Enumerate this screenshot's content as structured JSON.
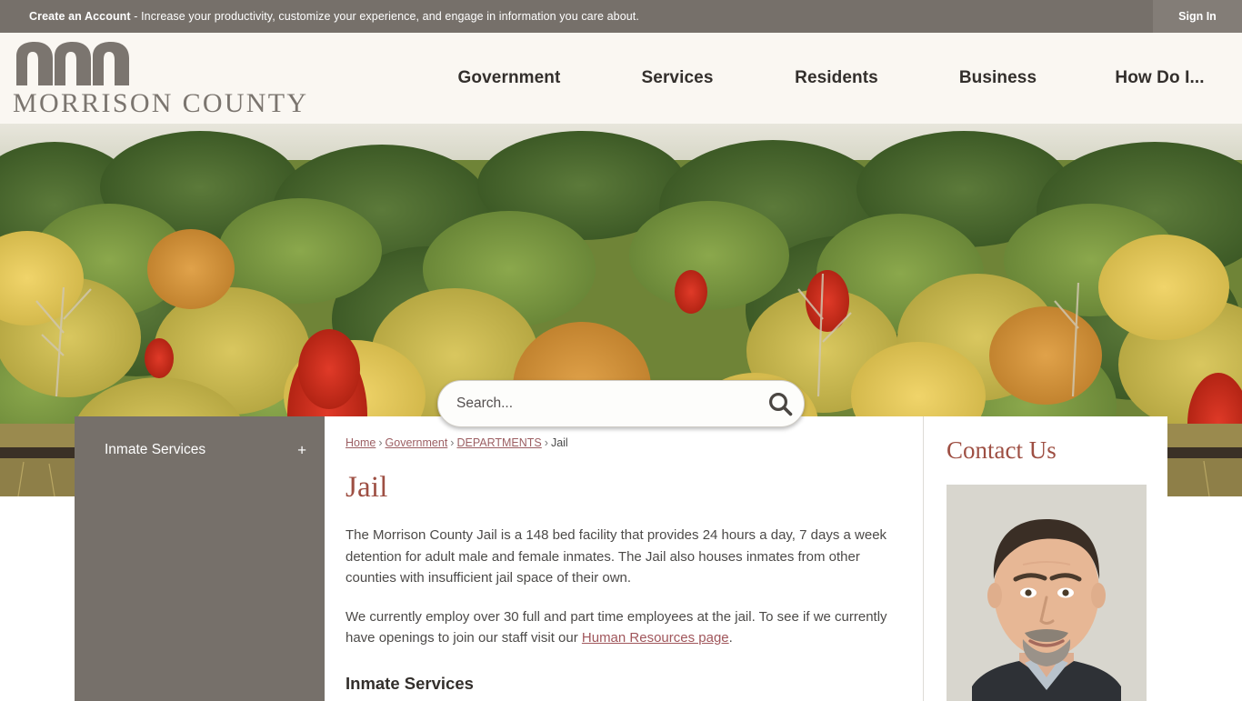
{
  "topbar": {
    "message_bold": "Create an Account",
    "message_rest": " - Increase your productivity, customize your experience, and engage in information you care about.",
    "sign_in_label": "Sign In"
  },
  "header": {
    "logo_text": "MORRISON COUNTY",
    "nav": [
      {
        "label": "Government"
      },
      {
        "label": "Services"
      },
      {
        "label": "Residents"
      },
      {
        "label": "Business"
      },
      {
        "label": "How Do I..."
      }
    ]
  },
  "hero": {
    "search": {
      "placeholder": "Search...",
      "value": "",
      "icon": "search-icon"
    }
  },
  "sidebar": {
    "items": [
      {
        "label": "Inmate Services",
        "expander": "+"
      }
    ]
  },
  "main": {
    "breadcrumb": [
      {
        "label": "Home",
        "link": true
      },
      {
        "label": "Government",
        "link": true
      },
      {
        "label": "DEPARTMENTS",
        "link": true
      },
      {
        "label": "Jail",
        "link": false
      }
    ],
    "breadcrumb_separator": "›",
    "title": "Jail",
    "paragraph_1": "The Morrison County Jail is a 148 bed facility that provides 24 hours a day, 7 days a week detention for adult male and female inmates. The Jail also houses inmates from other counties with insufficient jail space of their own.",
    "paragraph_2_before": "We currently employ over 30 full and part time employees at the jail. To see if we currently have openings to join our staff visit our ",
    "paragraph_2_link": "Human Resources page",
    "paragraph_2_after": ".",
    "subheading": "Inmate Services"
  },
  "contact": {
    "title": "Contact Us",
    "photo_alt": "staff-portrait"
  },
  "colors": {
    "topbar": "#76706a",
    "signin": "#837d77",
    "header_bg": "#faf7f2",
    "sidebar": "#76706a",
    "accent_maroon": "#9e4f43",
    "link": "#9c5f63",
    "body_text": "#4c4a48"
  }
}
